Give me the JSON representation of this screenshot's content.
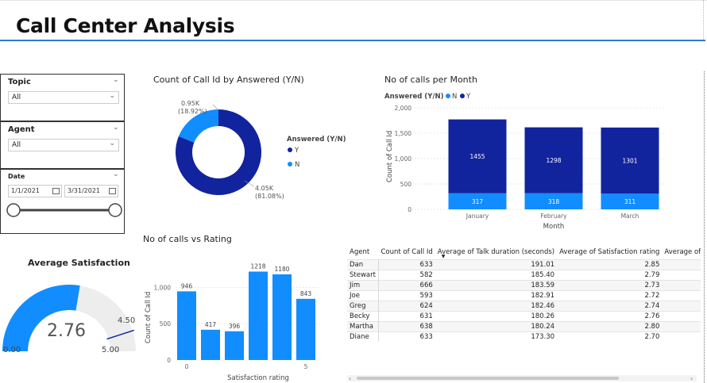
{
  "page": {
    "title": "Call Center Analysis"
  },
  "slicers": {
    "topic": {
      "label": "Topic",
      "value": "All"
    },
    "agent": {
      "label": "Agent",
      "value": "All"
    },
    "date": {
      "label": "Date",
      "start": "1/1/2021",
      "end": "3/31/2021"
    }
  },
  "gauge": {
    "title": "Average Satisfaction",
    "value": "2.76",
    "min": "0.00",
    "max": "5.00",
    "target": "4.50",
    "value_num": 2.76,
    "max_num": 5,
    "target_num": 4.5,
    "fill_color": "#118DFF",
    "track_color": "#EDEDED",
    "target_color": "#12239E"
  },
  "donut": {
    "title": "Count of Call Id by Answered (Y/N)",
    "legend_title": "Answered (Y/N)",
    "slices": [
      {
        "name": "Y",
        "label": "4.05K",
        "pct": "(81.08%)",
        "value": 4054,
        "color": "#12239E"
      },
      {
        "name": "N",
        "label": "0.95K",
        "pct": "(18.92%)",
        "value": 946,
        "color": "#118DFF"
      }
    ]
  },
  "monthly": {
    "title": "No of calls per Month",
    "legend_title": "Answered (Y/N)",
    "legend": [
      "N",
      "Y"
    ],
    "ylabel": "Count of Call Id",
    "xlabel": "Month",
    "yticks": [
      "2,000",
      "1,500",
      "1,000",
      "500",
      "0"
    ]
  },
  "rating": {
    "title": "No of calls vs Rating",
    "ylabel": "Count of Call Id",
    "xlabel": "Satisfaction rating",
    "yticks": [
      "1,000",
      "500",
      "0"
    ],
    "xticks": [
      "0",
      "5"
    ]
  },
  "table": {
    "columns": [
      "Agent",
      "Count of Call Id",
      "Average of Talk duration (seconds)",
      "Average of Satisfaction rating",
      "Average of Spe"
    ],
    "rows": [
      [
        "Dan",
        "633",
        "191.01",
        "2.85"
      ],
      [
        "Stewart",
        "582",
        "185.40",
        "2.79"
      ],
      [
        "Jim",
        "666",
        "183.59",
        "2.73"
      ],
      [
        "Joe",
        "593",
        "182.91",
        "2.72"
      ],
      [
        "Greg",
        "624",
        "182.46",
        "2.74"
      ],
      [
        "Becky",
        "631",
        "180.26",
        "2.76"
      ],
      [
        "Martha",
        "638",
        "180.24",
        "2.80"
      ],
      [
        "Diane",
        "633",
        "173.30",
        "2.70"
      ]
    ]
  },
  "chart_data": [
    {
      "type": "pie",
      "title": "Count of Call Id by Answered (Y/N)",
      "legend_title": "Answered (Y/N)",
      "categories": [
        "Y",
        "N"
      ],
      "values": [
        4054,
        946
      ],
      "data_labels": [
        "4.05K (81.08%)",
        "0.95K (18.92%)"
      ]
    },
    {
      "type": "bar",
      "title": "No of calls per Month",
      "categories": [
        "January",
        "February",
        "March"
      ],
      "xlabel": "Month",
      "ylabel": "Count of Call Id",
      "ylim": [
        0,
        2000
      ],
      "stacked": true,
      "legend": "top-left",
      "series": [
        {
          "name": "N",
          "values": [
            317,
            318,
            311
          ],
          "color": "#118DFF"
        },
        {
          "name": "Y",
          "values": [
            1455,
            1298,
            1301
          ],
          "color": "#12239E"
        }
      ]
    },
    {
      "type": "bar",
      "title": "No of calls vs Rating",
      "categories": [
        "0",
        "1",
        "2",
        "3",
        "4",
        "5"
      ],
      "values": [
        946,
        417,
        396,
        1218,
        1180,
        843
      ],
      "xlabel": "Satisfaction rating",
      "ylabel": "Count of Call Id",
      "ylim": [
        0,
        1300
      ],
      "color": "#118DFF"
    }
  ]
}
